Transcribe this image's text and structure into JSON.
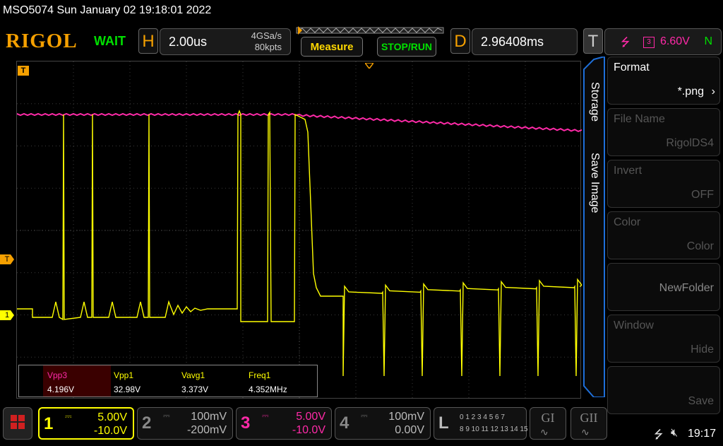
{
  "header": {
    "title": "MSO5074  Sun January 02 19:18:01 2022",
    "logo": "RIGOL",
    "status": "WAIT",
    "horizontal": {
      "key": "H",
      "timebase": "2.00us",
      "rate": "4GSa/s",
      "points": "80kpts"
    },
    "measure_button": "Measure",
    "stoprun_button": "STOP/RUN",
    "delay": {
      "key": "D",
      "value": "2.96408ms"
    },
    "trigger": {
      "key": "T",
      "source": "3",
      "level": "6.60V",
      "mode": "N"
    }
  },
  "markers": {
    "trigger_marker": "T",
    "ch1_marker": "1",
    "trigger_level_marker": "T"
  },
  "side_menu": {
    "tab_storage": "Storage",
    "tab_save_image": "Save Image",
    "items": [
      {
        "title": "Format",
        "value": "*.png",
        "state": "active"
      },
      {
        "title": "File Name",
        "value": "RigolDS4",
        "state": "dim"
      },
      {
        "title": "Invert",
        "value": "OFF",
        "state": "dim"
      },
      {
        "title": "Color",
        "value": "Color",
        "state": "dim"
      },
      {
        "title": "",
        "value": "NewFolder",
        "state": "dim"
      },
      {
        "title": "Window",
        "value": "Hide",
        "state": "dim"
      },
      {
        "title": "",
        "value": "Save",
        "state": "dim"
      }
    ]
  },
  "measurements": [
    {
      "name": "Vpp3",
      "value": "4.196V",
      "color": "#ff2aa8"
    },
    {
      "name": "Vpp1",
      "value": "32.98V",
      "color": "#ffff00"
    },
    {
      "name": "Vavg1",
      "value": "3.373V",
      "color": "#ffff00"
    },
    {
      "name": "Freq1",
      "value": "4.352MHz",
      "color": "#ffff00"
    }
  ],
  "channels": [
    {
      "num": "1",
      "scale": "5.00V",
      "offset": "-10.0V",
      "color": "#ffff00",
      "active": true
    },
    {
      "num": "2",
      "scale": "100mV",
      "offset": "-200mV",
      "color": "#888888",
      "active": false
    },
    {
      "num": "3",
      "scale": "5.00V",
      "offset": "-10.0V",
      "color": "#ff2aa8",
      "active": false
    },
    {
      "num": "4",
      "scale": "100mV",
      "offset": "0.00V",
      "color": "#888888",
      "active": false
    }
  ],
  "logic": {
    "key": "L",
    "row1": "0 1 2 3  4 5 6 7",
    "row2": "8 9 10 11  12 13 14 15"
  },
  "decoders": {
    "g1": "GI",
    "g2": "GII"
  },
  "clock": "19:17",
  "colors": {
    "ch1": "#ffff00",
    "ch3": "#ff2aa8",
    "accent": "#f5a000",
    "menu_blue": "#1e6fd9"
  }
}
